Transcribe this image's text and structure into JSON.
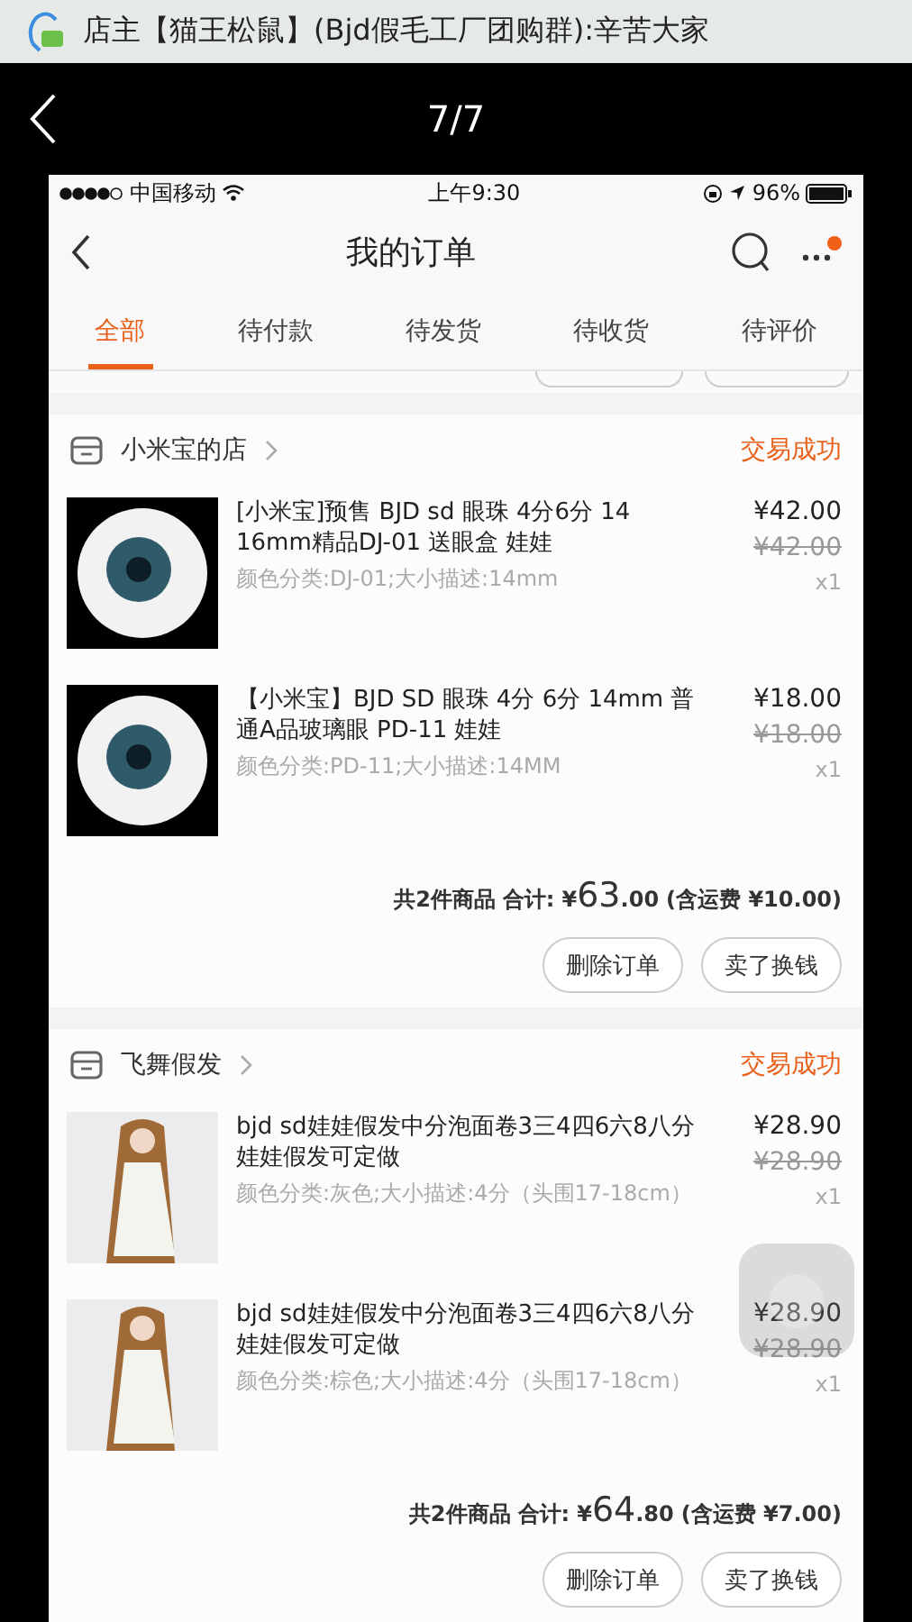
{
  "notification": {
    "text": "店主【猫王松鼠】(Bjd假毛工厂团购群):辛苦大家"
  },
  "viewer": {
    "counter": "7/7"
  },
  "status_bar": {
    "carrier": "中国移动",
    "time": "上午9:30",
    "battery": "96%"
  },
  "nav": {
    "title": "我的订单"
  },
  "tabs": [
    {
      "label": "全部",
      "selected": true
    },
    {
      "label": "待付款",
      "selected": false
    },
    {
      "label": "待发货",
      "selected": false
    },
    {
      "label": "待收货",
      "selected": false
    },
    {
      "label": "待评价",
      "selected": false
    }
  ],
  "orders": [
    {
      "shop": "小米宝的店",
      "status": "交易成功",
      "items": [
        {
          "kind": "eyeball",
          "title": "[小米宝]预售 BJD sd 眼珠 4分6分 14 16mm精品DJ-01 送眼盒 娃娃",
          "spec": "颜色分类:DJ-01;大小描述:14mm",
          "price": "¥42.00",
          "original_price": "¥42.00",
          "quantity": "x1"
        },
        {
          "kind": "eyeball",
          "title": "【小米宝】BJD SD 眼珠 4分 6分 14mm 普通A品玻璃眼 PD-11 娃娃",
          "spec": "颜色分类:PD-11;大小描述:14MM",
          "price": "¥18.00",
          "original_price": "¥18.00",
          "quantity": "x1"
        }
      ],
      "count": "共2件商品",
      "total_label": "合计:",
      "currency": "¥",
      "total_int": "63",
      "total_dec": ".00",
      "shipping": "(含运费 ¥10.00)",
      "buttons": [
        "删除订单",
        "卖了换钱"
      ]
    },
    {
      "shop": "飞舞假发",
      "status": "交易成功",
      "items": [
        {
          "kind": "doll",
          "title": "bjd sd娃娃假发中分泡面卷3三4四6六8八分娃娃假发可定做",
          "spec": "颜色分类:灰色;大小描述:4分（头围17-18cm）",
          "price": "¥28.90",
          "original_price": "¥28.90",
          "quantity": "x1"
        },
        {
          "kind": "doll",
          "title": "bjd sd娃娃假发中分泡面卷3三4四6六8八分娃娃假发可定做",
          "spec": "颜色分类:棕色;大小描述:4分（头围17-18cm）",
          "price": "¥28.90",
          "original_price": "¥28.90",
          "quantity": "x1"
        }
      ],
      "count": "共2件商品",
      "total_label": "合计:",
      "currency": "¥",
      "total_int": "64",
      "total_dec": ".80",
      "shipping": "(含运费 ¥7.00)",
      "buttons": [
        "删除订单",
        "卖了换钱"
      ]
    }
  ]
}
